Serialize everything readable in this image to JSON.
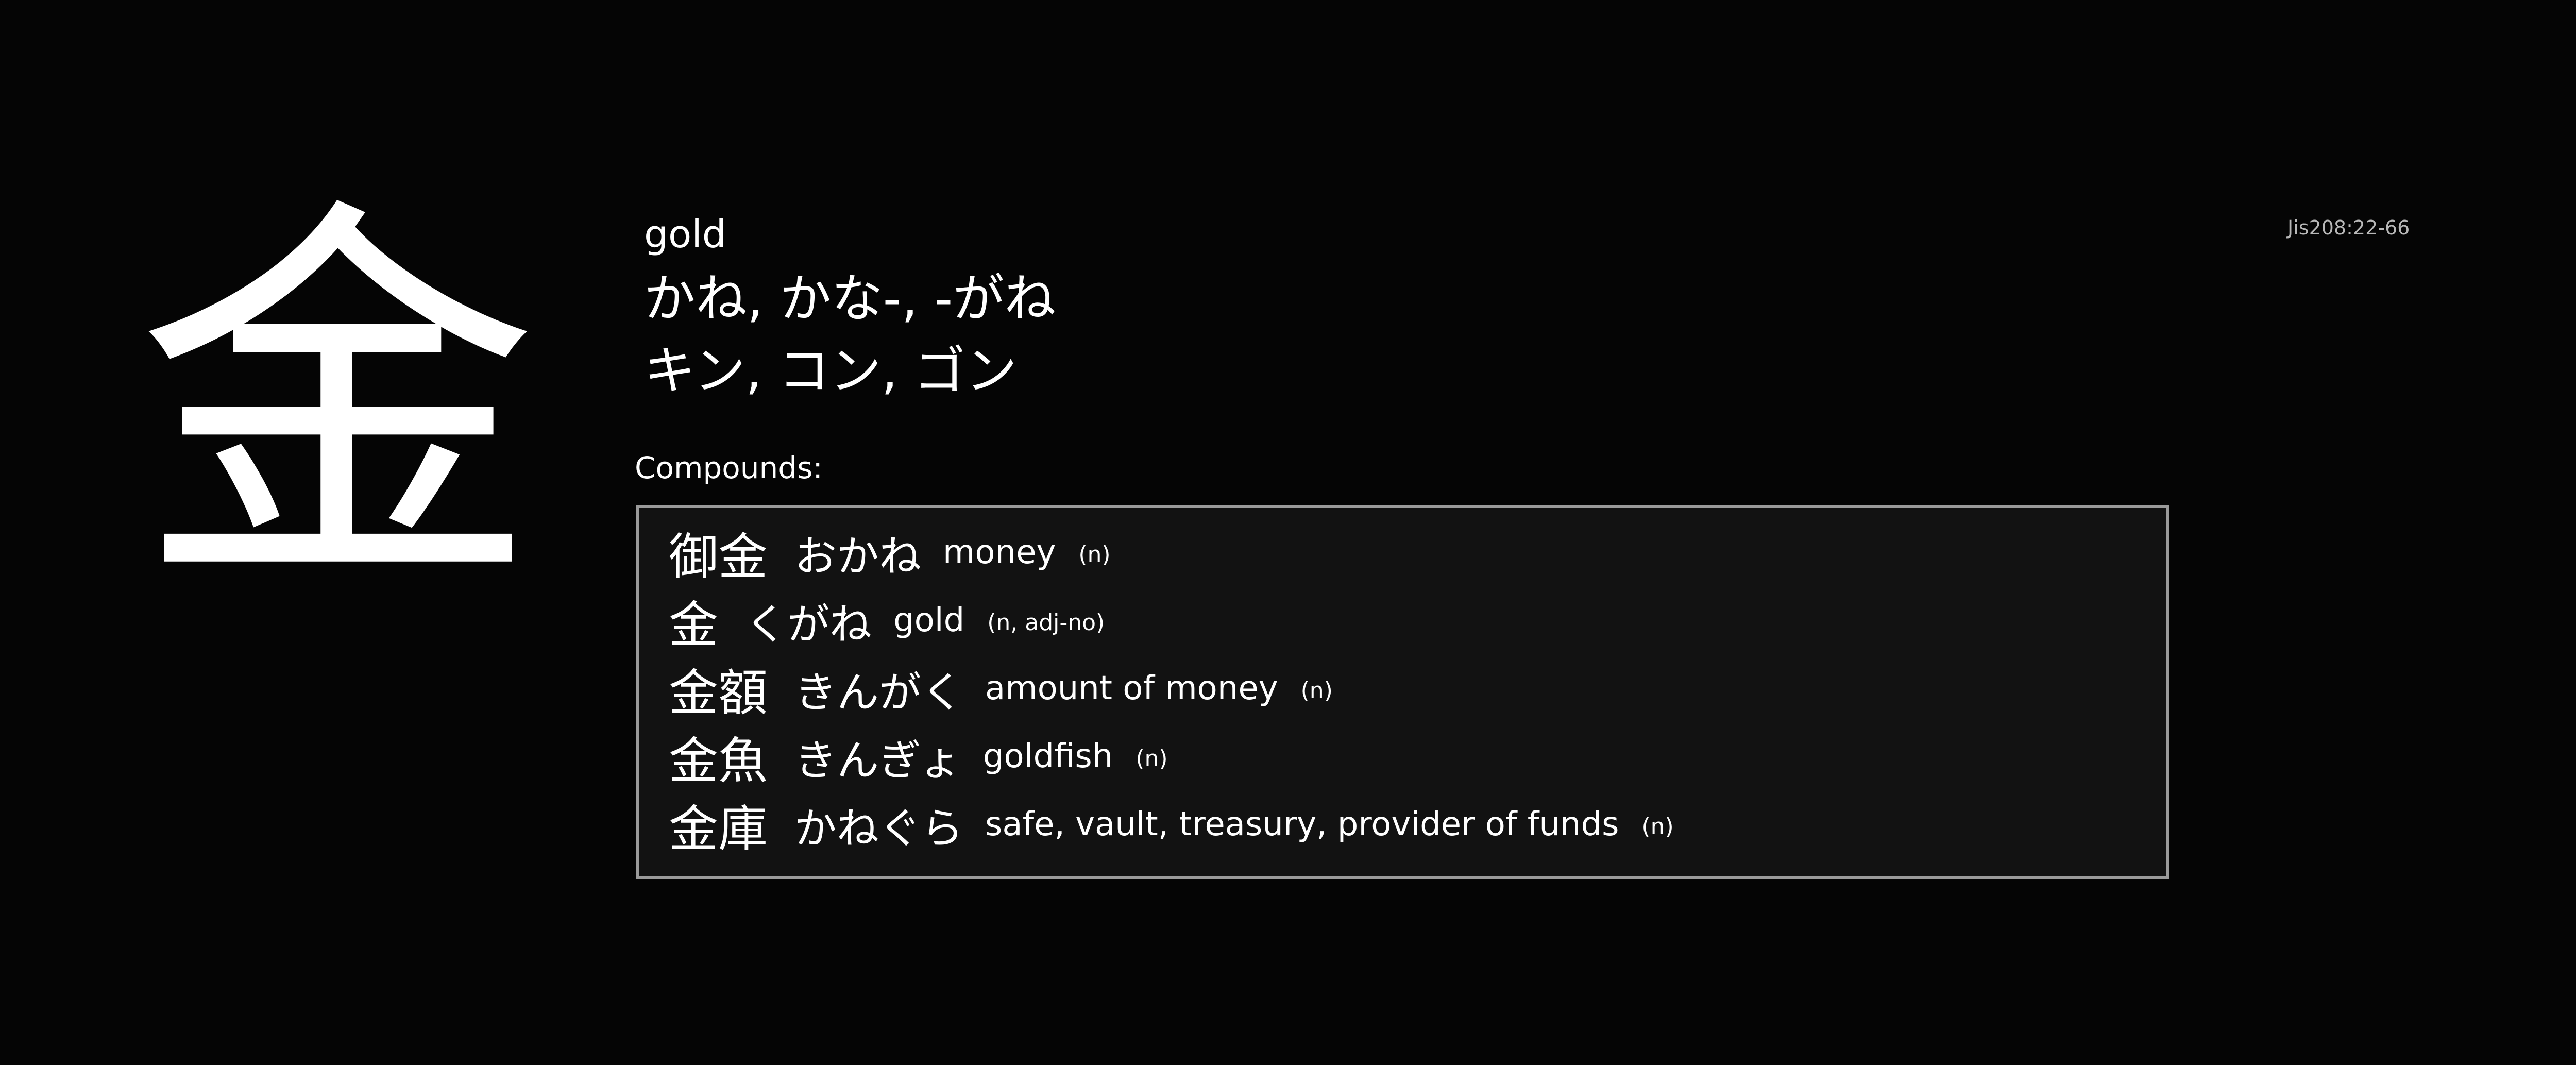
{
  "kanji": "金",
  "jis_code": "Jis208:22-66",
  "meaning": "gold",
  "kun_reading": "かね, かな-, -がね",
  "on_reading": "キン, コン, ゴン",
  "compounds_label": "Compounds:",
  "compounds": [
    {
      "word": "御金",
      "reading": "おかね",
      "gloss": "money",
      "pos": "(n)"
    },
    {
      "word": "金",
      "reading": "くがね",
      "gloss": "gold",
      "pos": "(n, adj-no)"
    },
    {
      "word": "金額",
      "reading": "きんがく",
      "gloss": "amount of money",
      "pos": "(n)"
    },
    {
      "word": "金魚",
      "reading": "きんぎょ",
      "gloss": "goldfish",
      "pos": "(n)"
    },
    {
      "word": "金庫",
      "reading": "かねぐら",
      "gloss": "safe, vault, treasury, provider of funds",
      "pos": "(n)"
    }
  ],
  "colors": {
    "background": "#050505",
    "box_background": "#121212",
    "box_border": "#9a9a9a",
    "text": "#ffffff",
    "muted_text": "#b8b8b8"
  }
}
